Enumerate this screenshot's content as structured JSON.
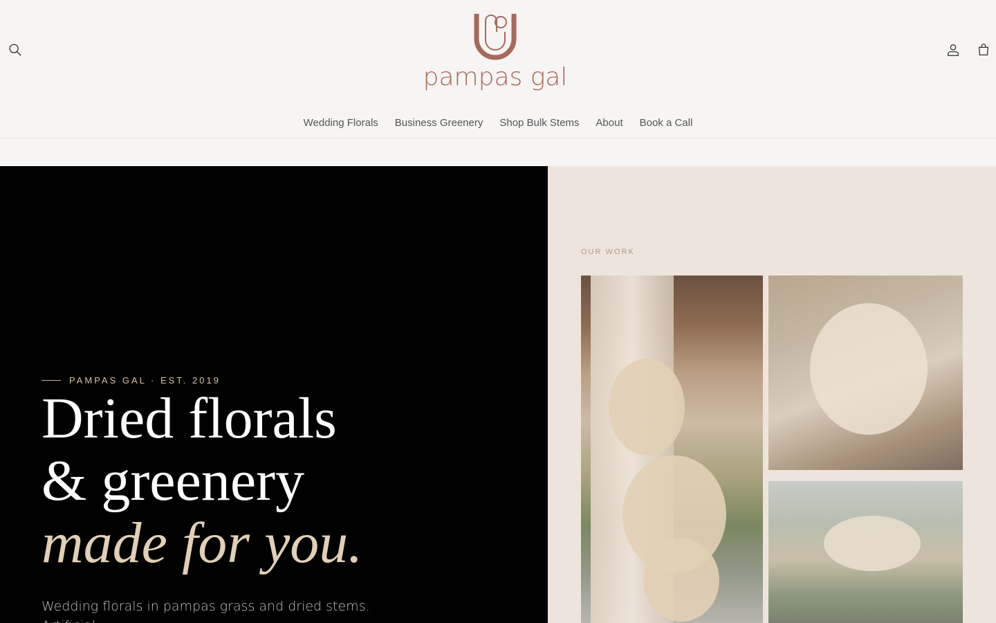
{
  "brand": {
    "name": "pampas gal",
    "accent": "#a8685a"
  },
  "header": {
    "search_icon": "search-icon",
    "account_icon": "account-icon",
    "cart_icon": "cart-icon"
  },
  "nav": {
    "items": [
      {
        "label": "Wedding Florals"
      },
      {
        "label": "Business Greenery"
      },
      {
        "label": "Shop Bulk Stems"
      },
      {
        "label": "About"
      },
      {
        "label": "Book a Call"
      }
    ]
  },
  "hero": {
    "eyebrow": "PAMPAS GAL · EST. 2019",
    "headline_line1": "Dried florals",
    "headline_line2": "& greenery",
    "headline_line3": "made for you.",
    "body": "Wedding florals in pampas grass and dried stems. Artificial",
    "colors": {
      "left_bg": "#000000",
      "right_bg": "#ede5dd",
      "accent_text": "#e1cfb6"
    }
  },
  "gallery": {
    "label": "OUR WORK"
  }
}
